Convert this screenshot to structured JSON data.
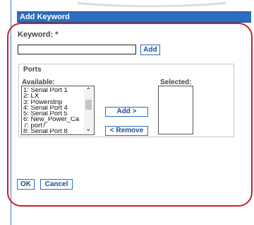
{
  "header": {
    "title": "Add Keyword"
  },
  "keyword": {
    "label": "Keyword: *",
    "value": "",
    "add_button": "Add"
  },
  "ports": {
    "legend": "Ports",
    "available_label": "Available:",
    "selected_label": "Selected:",
    "available_items": [
      "1: Serial Port 1",
      "2: LX",
      "3: Powerstrip",
      "4: Serial Port 4",
      "5: Serial Port 5",
      "6: New_Power_Ca",
      "7: port7",
      "8: Serial Port 8"
    ],
    "selected_items": [],
    "add_button": "Add >",
    "remove_button": "< Remove"
  },
  "footer": {
    "ok_button": "OK",
    "cancel_button": "Cancel"
  },
  "colors": {
    "header_bg": "#2d6dbf",
    "button_border": "#2d6dbf",
    "callout_border": "#c81e2a"
  }
}
